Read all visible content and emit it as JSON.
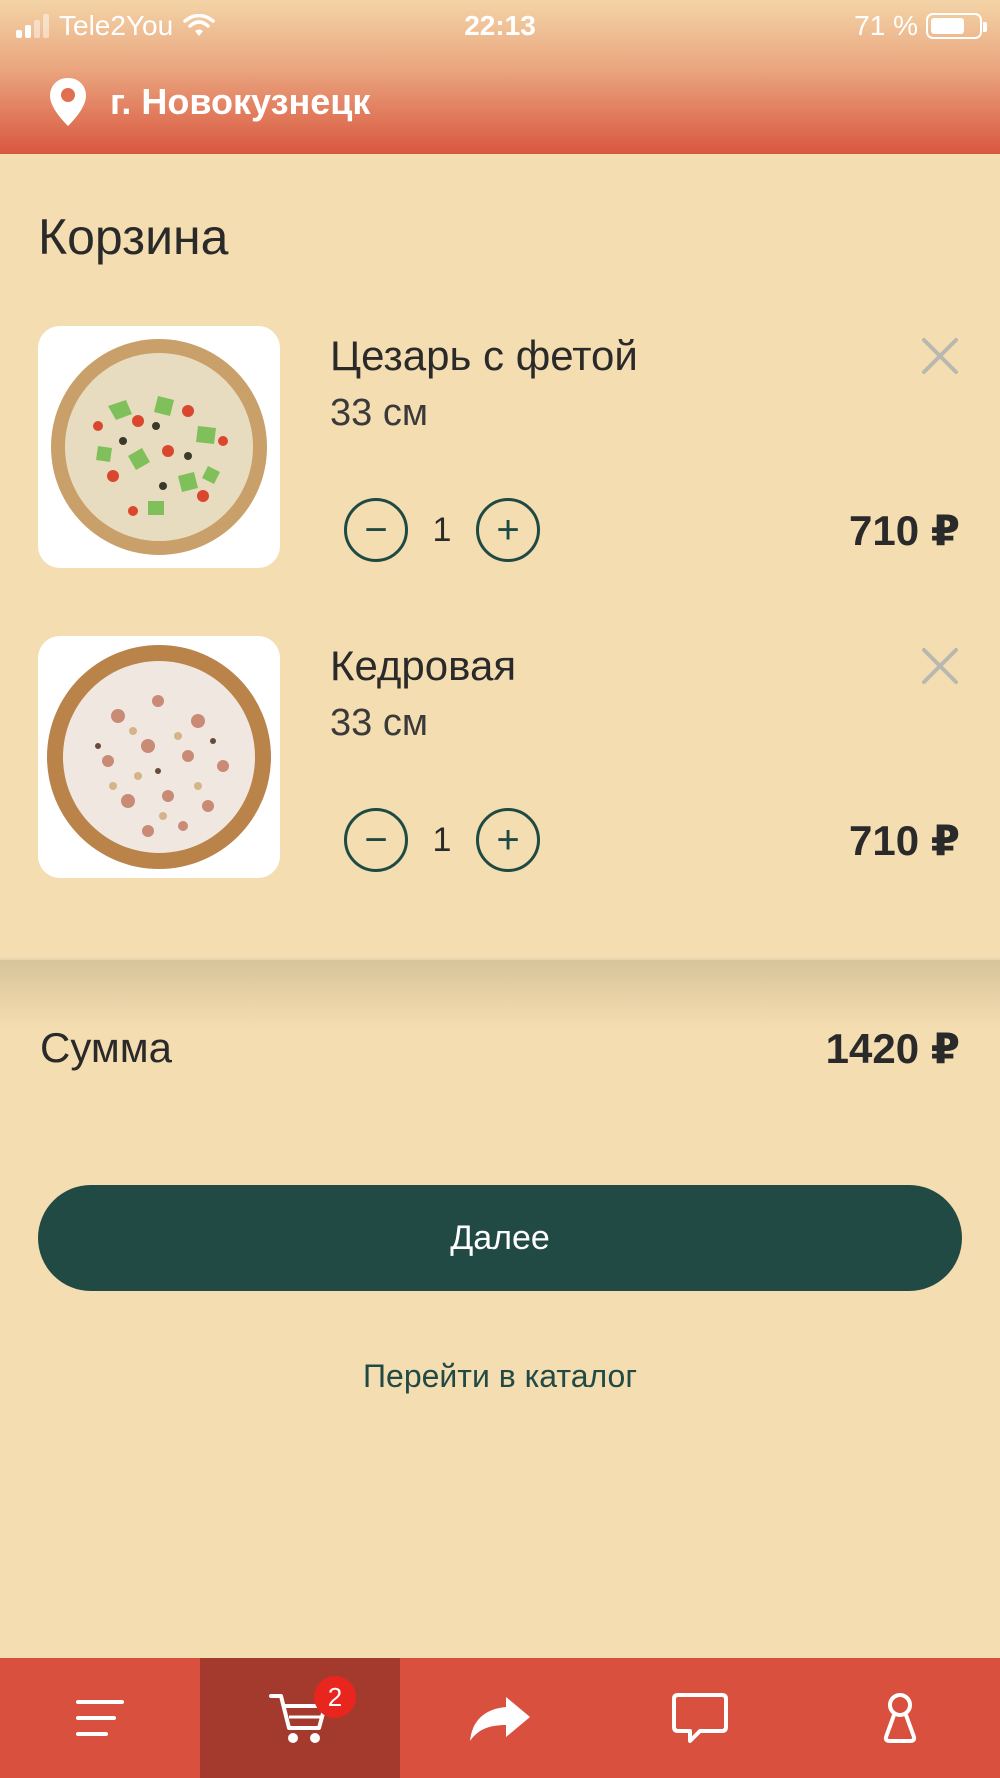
{
  "status_bar": {
    "carrier": "Tele2You",
    "time": "22:13",
    "battery": "71 %"
  },
  "header": {
    "city": "г. Новокузнецк"
  },
  "page": {
    "title": "Корзина"
  },
  "cart": {
    "items": [
      {
        "name": "Цезарь с фетой",
        "size": "33 см",
        "quantity": "1",
        "price": "710 ₽",
        "image": "pizza-caesar-feta"
      },
      {
        "name": "Кедровая",
        "size": "33 см",
        "quantity": "1",
        "price": "710 ₽",
        "image": "pizza-kedrovaya"
      }
    ],
    "minus_symbol": "−",
    "plus_symbol": "+"
  },
  "summary": {
    "label": "Сумма",
    "value": "1420 ₽"
  },
  "actions": {
    "next_label": "Далее",
    "catalog_label": "Перейти в каталог"
  },
  "tabbar": {
    "tabs": [
      {
        "icon": "menu-icon"
      },
      {
        "icon": "cart-icon",
        "badge": "2",
        "active": true
      },
      {
        "icon": "share-icon"
      },
      {
        "icon": "chat-icon"
      },
      {
        "icon": "profile-icon"
      }
    ]
  },
  "colors": {
    "background": "#f4ddb0",
    "header": "#d9573f",
    "primary": "#214a45",
    "tabbar": "#d9503f",
    "tab_active": "#a43a2d",
    "badge": "#e8261e"
  }
}
